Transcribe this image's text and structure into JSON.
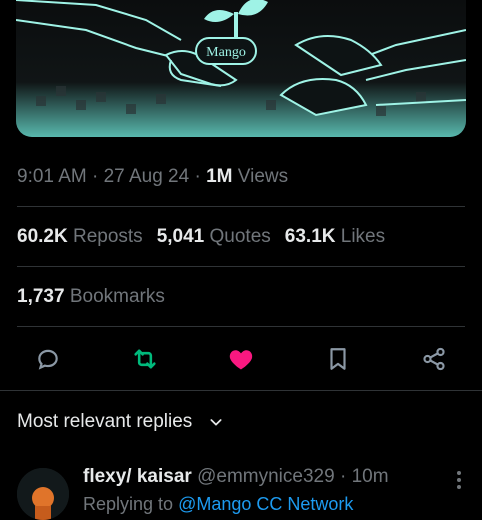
{
  "media": {
    "logo_text": "Mango",
    "accent": "#9ff3e6"
  },
  "meta": {
    "time": "9:01 AM",
    "sep1": " · ",
    "date": "27 Aug 24",
    "sep2": " · ",
    "views_num": "1M",
    "views_label": " Views"
  },
  "stats": {
    "reposts_num": "60.2K",
    "reposts_label": "Reposts",
    "quotes_num": "5,041",
    "quotes_label": "Quotes",
    "likes_num": "63.1K",
    "likes_label": "Likes"
  },
  "bookmarks": {
    "num": "1,737",
    "label": "Bookmarks"
  },
  "actions": {
    "reply_icon": "reply-icon",
    "repost_icon": "repost-icon",
    "like_icon": "heart-icon",
    "bookmark_icon": "bookmark-icon",
    "share_icon": "share-icon",
    "repost_color": "#00ba7c",
    "like_color": "#f91880"
  },
  "replies": {
    "heading": "Most relevant replies"
  },
  "reply": {
    "name": "flexy/ kaisar",
    "handle": "@emmynice329",
    "sep": " · ",
    "time": "10m",
    "body_prefix": "Replying to ",
    "body_mention": "@Mango CC Network"
  }
}
